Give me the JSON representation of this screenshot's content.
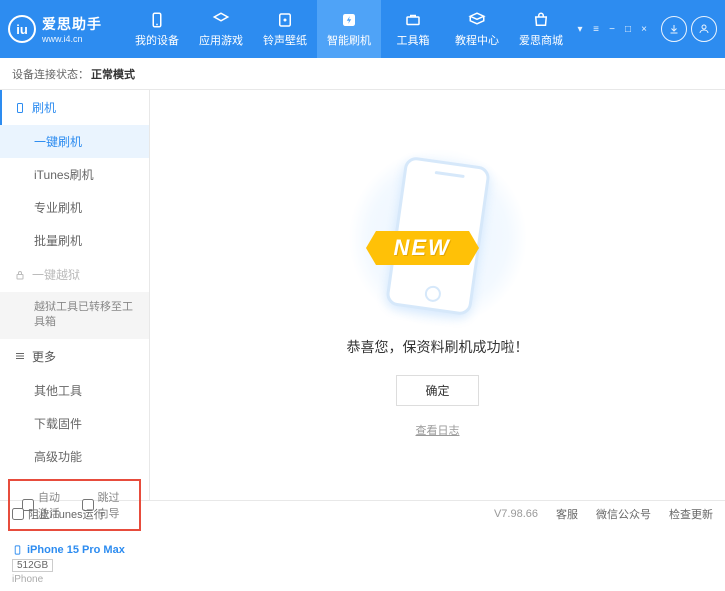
{
  "app": {
    "title": "爱思助手",
    "url": "www.i4.cn"
  },
  "nav": [
    {
      "label": "我的设备"
    },
    {
      "label": "应用游戏"
    },
    {
      "label": "铃声壁纸"
    },
    {
      "label": "智能刷机"
    },
    {
      "label": "工具箱"
    },
    {
      "label": "教程中心"
    },
    {
      "label": "爱思商城"
    }
  ],
  "status": {
    "label": "设备连接状态：",
    "value": "正常模式"
  },
  "sidebar": {
    "flash": "刷机",
    "items1": [
      "一键刷机",
      "iTunes刷机",
      "专业刷机",
      "批量刷机"
    ],
    "jailbreak": "一键越狱",
    "jailbreak_note": "越狱工具已转移至工具箱",
    "more": "更多",
    "items2": [
      "其他工具",
      "下载固件",
      "高级功能"
    ]
  },
  "checks": {
    "auto_activate": "自动激活",
    "skip_guide": "跳过向导"
  },
  "device": {
    "name": "iPhone 15 Pro Max",
    "capacity": "512GB",
    "type": "iPhone"
  },
  "main": {
    "banner": "NEW",
    "message": "恭喜您，保资料刷机成功啦！",
    "ok": "确定",
    "log": "查看日志"
  },
  "footer": {
    "block_itunes": "阻止iTunes运行",
    "version": "V7.98.66",
    "support": "客服",
    "wechat": "微信公众号",
    "update": "检查更新"
  }
}
